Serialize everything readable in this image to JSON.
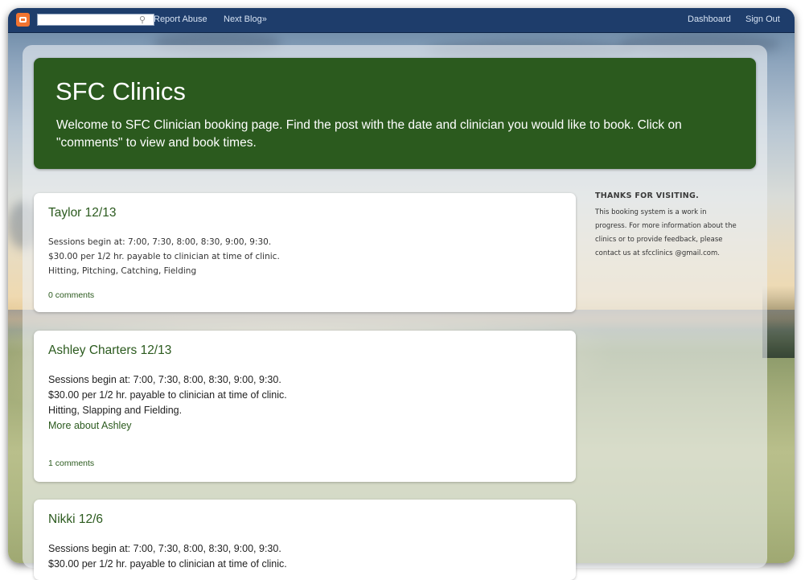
{
  "navbar": {
    "logo_icon": "blogger-logo-icon",
    "search_placeholder": "",
    "search_button_icon": "search-icon",
    "report_abuse": "Report Abuse",
    "next_blog": "Next Blog»",
    "dashboard": "Dashboard",
    "sign_out": "Sign Out",
    "color": "#1e3d6b"
  },
  "header": {
    "title": "SFC Clinics",
    "description": "Welcome to SFC Clinician booking page. Find the post with the date and clinician you would like to book. Click on \"comments\" to view and book times.",
    "color": "#2b5a1e"
  },
  "posts": [
    {
      "title": "Taylor 12/13",
      "lines": [
        "Sessions begin at: 7:00, 7:30, 8:00, 8:30, 9:00, 9:30.",
        "$30.00 per 1/2 hr. payable to clinician at time of clinic.",
        "Hitting, Pitching, Catching, Fielding"
      ],
      "comments": "0 comments"
    },
    {
      "title": "Ashley Charters 12/13",
      "lines": [
        "Sessions begin at: 7:00, 7:30, 8:00, 8:30, 9:00, 9:30.",
        "$30.00 per 1/2 hr. payable to clinician at time of clinic.",
        "Hitting, Slapping and Fielding."
      ],
      "more_link": "More about Ashley",
      "comments": "1 comments"
    },
    {
      "title": "Nikki 12/6",
      "lines": [
        "Sessions begin at: 7:00, 7:30, 8:00, 8:30, 9:00, 9:30.",
        "$30.00 per 1/2 hr. payable to clinician at time of clinic."
      ]
    }
  ],
  "sidebar": {
    "title": "THANKS FOR VISITING.",
    "text": "This booking system is a work in progress. For more information about the clinics or to provide feedback, please contact us at sfcclinics @gmail.com."
  }
}
